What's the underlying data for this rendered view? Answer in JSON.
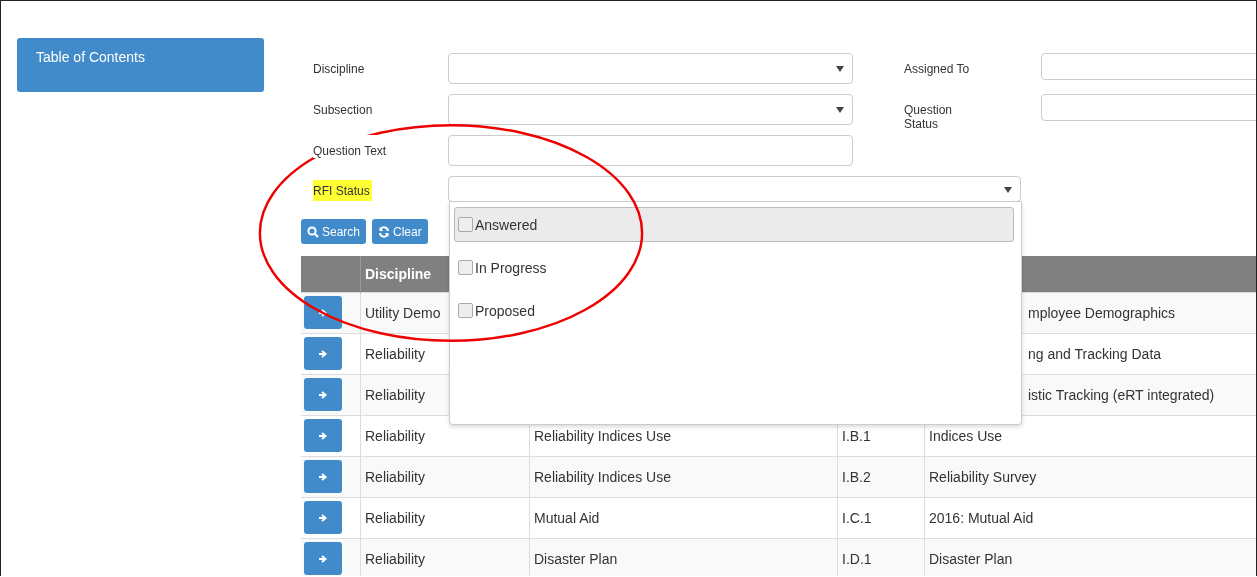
{
  "sidebar": {
    "button": "Table of Contents"
  },
  "form": {
    "left_fields": [
      {
        "label": "Discipline",
        "kind": "select"
      },
      {
        "label": "Subsection",
        "kind": "select"
      },
      {
        "label": "Question Text",
        "kind": "text"
      },
      {
        "label": "RFI Status",
        "kind": "select",
        "highlighted": true
      }
    ],
    "right_fields": [
      {
        "label": "Assigned To"
      },
      {
        "label": "Question Status"
      }
    ]
  },
  "buttons": [
    {
      "label": "Search"
    },
    {
      "label": "Clear"
    }
  ],
  "rfi_dropdown": {
    "options": [
      {
        "label": "Answered",
        "checked": false,
        "selected": true
      },
      {
        "label": "In Progress",
        "checked": false,
        "selected": false
      },
      {
        "label": "Proposed",
        "checked": false,
        "selected": false
      }
    ]
  },
  "table": {
    "columns": [
      "Discipline"
    ],
    "rows": [
      {
        "cells": [
          "Utility Demo",
          "",
          "",
          "mployee Demographics"
        ]
      },
      {
        "cells": [
          "Reliability",
          "",
          "",
          "ng and Tracking Data"
        ]
      },
      {
        "cells": [
          "Reliability",
          "",
          "",
          "istic Tracking (eRT integrated)"
        ]
      },
      {
        "cells": [
          "Reliability",
          "Reliability Indices Use",
          "I.B.1",
          "Indices Use"
        ]
      },
      {
        "cells": [
          "Reliability",
          "Reliability Indices Use",
          "I.B.2",
          "Reliability Survey"
        ]
      },
      {
        "cells": [
          "Reliability",
          "Mutual Aid",
          "I.C.1",
          "2016: Mutual Aid"
        ]
      },
      {
        "cells": [
          "Reliability",
          "Disaster Plan",
          "I.D.1",
          "Disaster Plan"
        ]
      }
    ]
  },
  "annotation": {
    "kind": "ellipse"
  }
}
